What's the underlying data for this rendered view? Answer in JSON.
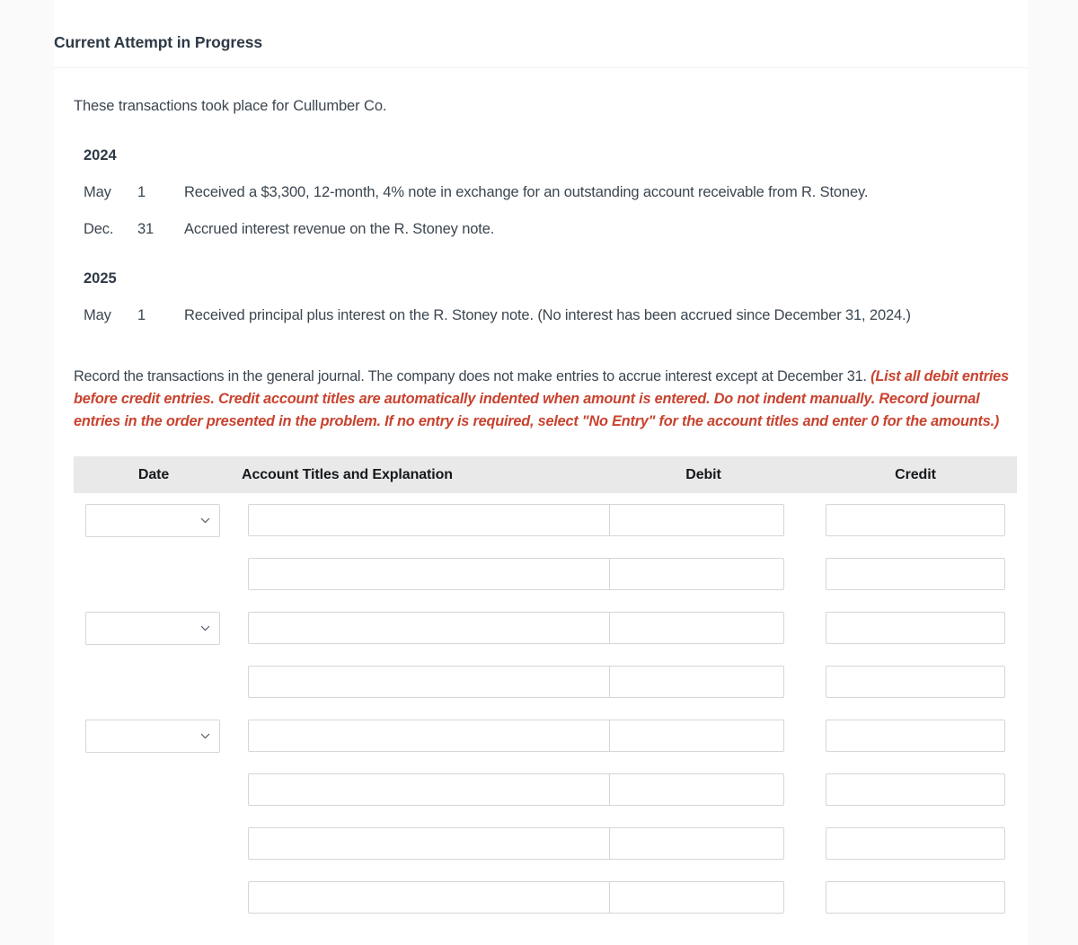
{
  "header": {
    "attempt_title": "Current Attempt in Progress"
  },
  "intro": {
    "line": "These transactions took place for Cullumber Co."
  },
  "transactions": [
    {
      "year": "2024",
      "entries": [
        {
          "month": "May",
          "day": "1",
          "description": "Received a $3,300, 12-month, 4% note in exchange for an outstanding account receivable from R. Stoney."
        },
        {
          "month": "Dec.",
          "day": "31",
          "description": "Accrued interest revenue on the R. Stoney note."
        }
      ]
    },
    {
      "year": "2025",
      "entries": [
        {
          "month": "May",
          "day": "1",
          "description": "Received principal plus interest on the R. Stoney note. (No interest has been accrued since December 31, 2024.)"
        }
      ]
    }
  ],
  "instructions": {
    "plain": "Record the transactions in the general journal. The company does not make entries to accrue interest except at December 31. ",
    "hint": "(List all debit entries before credit entries. Credit account titles are automatically indented when amount is entered. Do not indent manually. Record journal entries in the order presented in the problem. If no entry is required, select \"No Entry\" for the account titles and enter 0 for the amounts.)",
    "hint_color": "#c8432f"
  },
  "journal": {
    "columns": {
      "date": "Date",
      "account": "Account Titles and Explanation",
      "debit": "Debit",
      "credit": "Credit"
    },
    "header_bg": "#e9e9e9",
    "select_placeholder": "",
    "rows": [
      {
        "has_date": true,
        "date_value": "",
        "account_value": "",
        "debit_value": "",
        "credit_value": ""
      },
      {
        "has_date": false,
        "date_value": "",
        "account_value": "",
        "debit_value": "",
        "credit_value": ""
      },
      {
        "has_date": true,
        "date_value": "",
        "account_value": "",
        "debit_value": "",
        "credit_value": ""
      },
      {
        "has_date": false,
        "date_value": "",
        "account_value": "",
        "debit_value": "",
        "credit_value": ""
      },
      {
        "has_date": true,
        "date_value": "",
        "account_value": "",
        "debit_value": "",
        "credit_value": ""
      },
      {
        "has_date": false,
        "date_value": "",
        "account_value": "",
        "debit_value": "",
        "credit_value": ""
      },
      {
        "has_date": false,
        "date_value": "",
        "account_value": "",
        "debit_value": "",
        "credit_value": ""
      },
      {
        "has_date": false,
        "date_value": "",
        "account_value": "",
        "debit_value": "",
        "credit_value": ""
      }
    ]
  }
}
